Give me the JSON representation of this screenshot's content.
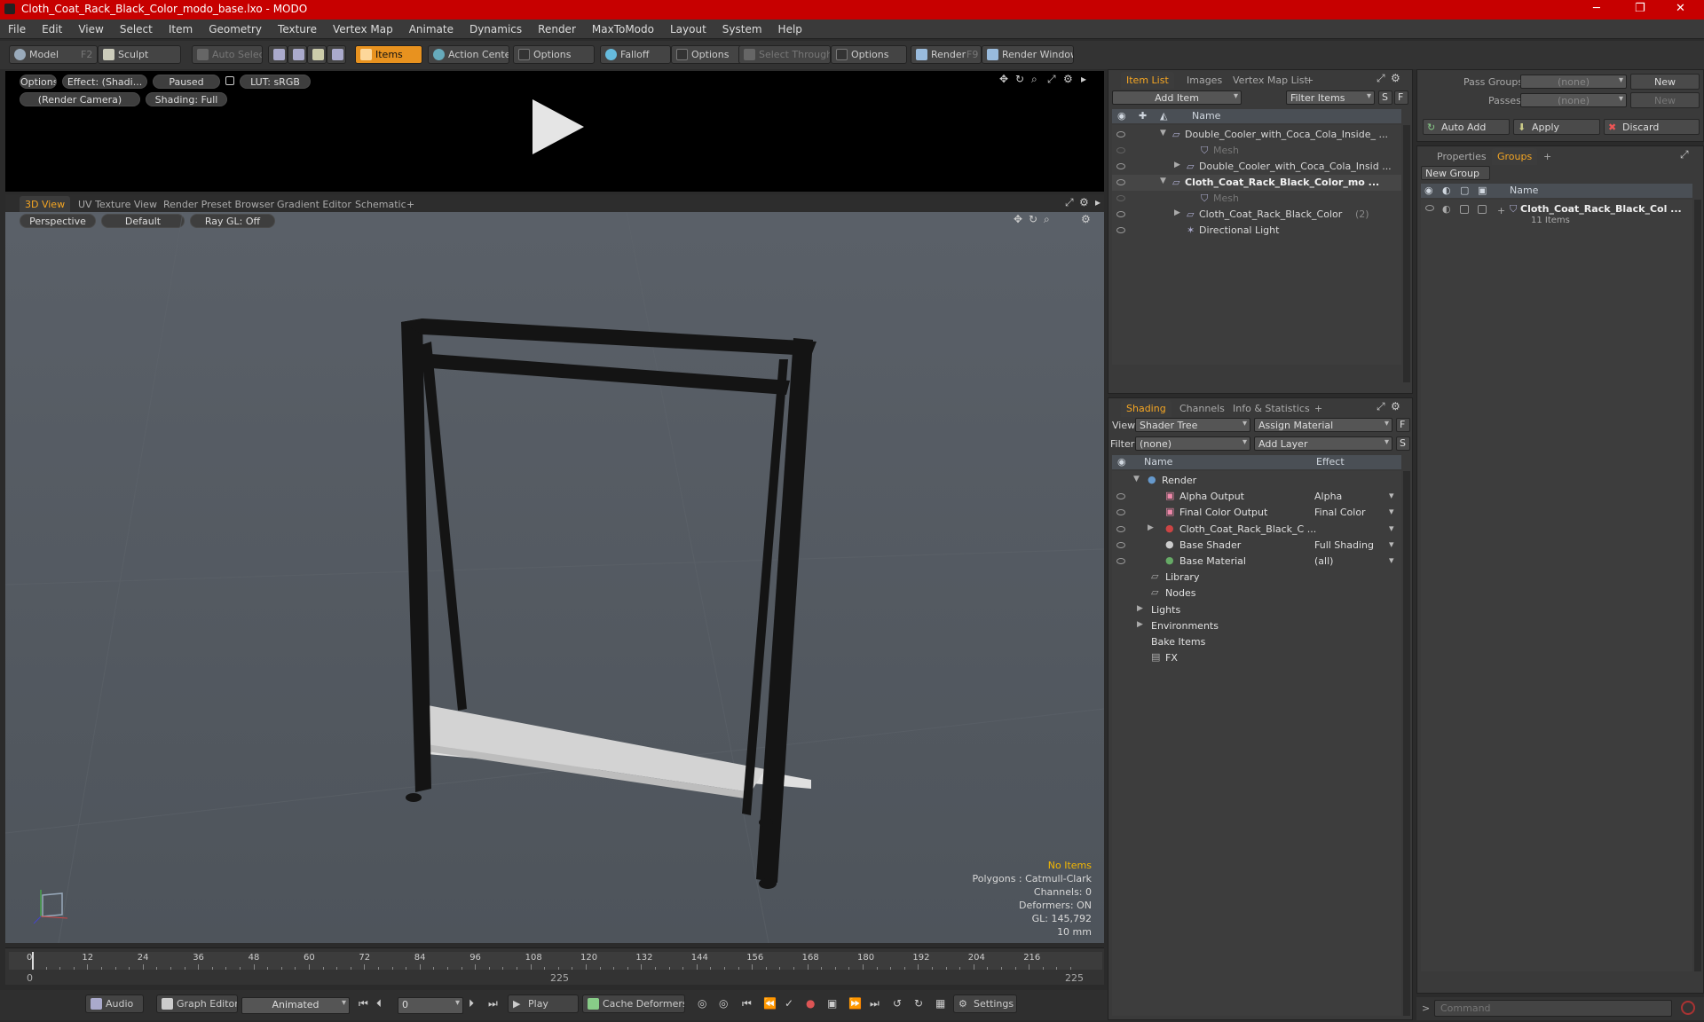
{
  "window": {
    "title": "Cloth_Coat_Rack_Black_Color_modo_base.lxo - MODO",
    "minimize": "─",
    "maximize": "❐",
    "close": "✕"
  },
  "menu": [
    "File",
    "Edit",
    "View",
    "Select",
    "Item",
    "Geometry",
    "Texture",
    "Vertex Map",
    "Animate",
    "Dynamics",
    "Render",
    "MaxToModo",
    "Layout",
    "System",
    "Help"
  ],
  "toolbar": {
    "model": "Model",
    "model_key": "F2",
    "sculpt": "Sculpt",
    "auto_select": "Auto Select",
    "items": "Items",
    "action_center": "Action Center",
    "options1": "Options",
    "falloff": "Falloff",
    "options2": "Options",
    "select_through": "Select Through",
    "options3": "Options",
    "render": "Render",
    "render_key": "F9",
    "render_window": "Render Window"
  },
  "preview": {
    "options": "Options",
    "effect": "Effect: (Shadi...",
    "paused": "Paused",
    "lut": "LUT: sRGB",
    "camera": "(Render Camera)",
    "shading": "Shading: Full"
  },
  "viewtabs": [
    "3D View",
    "UV Texture View",
    "Render Preset Browser",
    "Gradient Editor",
    "Schematic",
    "+"
  ],
  "viewport": {
    "perspective": "Perspective",
    "default": "Default",
    "raygl": "Ray GL: Off",
    "info": {
      "no_items": "No Items",
      "polygons": "Polygons : Catmull-Clark",
      "channels": "Channels: 0",
      "deformers": "Deformers: ON",
      "gl": "GL: 145,792",
      "scale": "10 mm"
    }
  },
  "timeline": {
    "ticks": [
      "0",
      "12",
      "24",
      "36",
      "48",
      "60",
      "72",
      "84",
      "96",
      "108",
      "120",
      "132",
      "144",
      "156",
      "168",
      "180",
      "192",
      "204",
      "216"
    ],
    "start": "0",
    "mid": "225",
    "end": "225"
  },
  "transport": {
    "audio": "Audio",
    "graph_editor": "Graph Editor",
    "animated": "Animated",
    "frame": "0",
    "play": "Play",
    "cache": "Cache Deformers",
    "settings": "Settings"
  },
  "itemlist": {
    "tabs": [
      "Item List",
      "Images",
      "Vertex Map List",
      "+"
    ],
    "add_item": "Add Item",
    "filter": "Filter Items",
    "s": "S",
    "f": "F",
    "col_name": "Name",
    "rows": [
      {
        "label": "Double_Cooler_with_Coca_Cola_Inside_ ...",
        "bold": false,
        "indent": 0,
        "arrow": "▼"
      },
      {
        "label": "Mesh",
        "dim": true,
        "indent": 2,
        "arrow": ""
      },
      {
        "label": "Double_Cooler_with_Coca_Cola_Insid ...",
        "indent": 1,
        "arrow": "▶"
      },
      {
        "label": "Cloth_Coat_Rack_Black_Color_mo ...",
        "bold": true,
        "indent": 0,
        "arrow": "▼"
      },
      {
        "label": "Mesh",
        "dim": true,
        "indent": 2,
        "arrow": ""
      },
      {
        "label": "Cloth_Coat_Rack_Black_Color",
        "count": "(2)",
        "indent": 1,
        "arrow": "▶"
      },
      {
        "label": "Directional Light",
        "indent": 1,
        "arrow": ""
      }
    ]
  },
  "shading": {
    "tabs": [
      "Shading",
      "Channels",
      "Info & Statistics",
      "+"
    ],
    "view_label": "View",
    "view_value": "Shader Tree",
    "assign": "Assign Material",
    "filter_label": "Filter",
    "filter_value": "(none)",
    "add_layer": "Add Layer",
    "f": "F",
    "s": "S",
    "col_name": "Name",
    "col_effect": "Effect",
    "rows": [
      {
        "label": "Render",
        "effect": "",
        "indent": 0,
        "arrow": "▼"
      },
      {
        "label": "Alpha Output",
        "effect": "Alpha",
        "indent": 1
      },
      {
        "label": "Final Color Output",
        "effect": "Final Color",
        "indent": 1
      },
      {
        "label": "Cloth_Coat_Rack_Black_C ...",
        "effect": "",
        "indent": 1,
        "arrow": "▶"
      },
      {
        "label": "Base Shader",
        "effect": "Full Shading",
        "indent": 1
      },
      {
        "label": "Base Material",
        "effect": "(all)",
        "indent": 1
      },
      {
        "label": "Library",
        "effect": "",
        "indent": 0
      },
      {
        "label": "Nodes",
        "effect": "",
        "indent": 0
      },
      {
        "label": "Lights",
        "effect": "",
        "indent": -1,
        "arrow": "▶"
      },
      {
        "label": "Environments",
        "effect": "",
        "indent": -1,
        "arrow": "▶"
      },
      {
        "label": "Bake Items",
        "effect": "",
        "indent": -1
      },
      {
        "label": "FX",
        "effect": "",
        "indent": 0
      }
    ]
  },
  "right": {
    "pass_groups": "Pass Groups",
    "passes": "Passes",
    "none": "(none)",
    "new": "New",
    "auto_add": "Auto Add",
    "apply": "Apply",
    "discard": "Discard",
    "tabs": [
      "Properties",
      "Groups",
      "+"
    ],
    "new_group": "New Group",
    "col_name": "Name",
    "group_name": "Cloth_Coat_Rack_Black_Col ...",
    "group_count": "11 Items",
    "command": "Command"
  }
}
